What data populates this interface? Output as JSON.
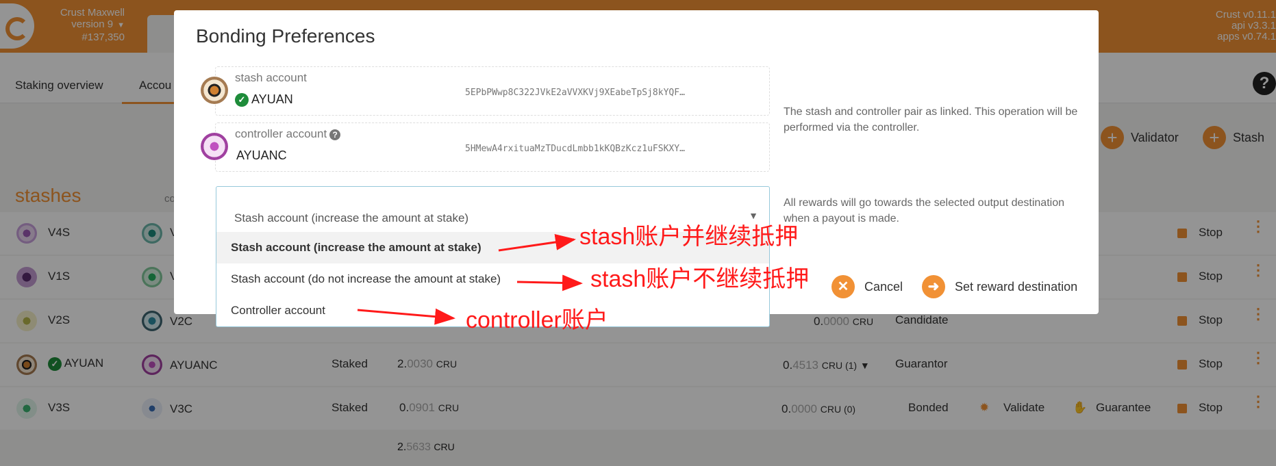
{
  "header": {
    "chain_name": "Crust Maxwell",
    "chain_version": "version 9",
    "block_number": "#137,350",
    "versions": [
      "Crust v0.11.1",
      "api v3.3.1",
      "apps v0.74.1"
    ]
  },
  "subnav": {
    "tabs": [
      "Staking overview",
      "Accou"
    ],
    "help": "?"
  },
  "actions": {
    "validator_label": "Validator",
    "stash_label": "Stash",
    "plus": "+"
  },
  "stashes": {
    "title": "stashes",
    "col_hint": "co",
    "rows": [
      {
        "stash": "V4S",
        "controller": "V",
        "status": "",
        "bonded": "",
        "bonded_dim": "",
        "unit": "",
        "rewards": "",
        "state": "",
        "stop": "Stop"
      },
      {
        "stash": "V1S",
        "controller": "V",
        "status": "",
        "bonded": "",
        "bonded_dim": "",
        "unit": "",
        "rewards": "",
        "state": "",
        "stop": "Stop"
      },
      {
        "stash": "V2S",
        "controller": "V2C",
        "status": "",
        "bonded": "",
        "bonded_dim": "",
        "unit": "",
        "rewards_main": "0.",
        "rewards_dim": "0000",
        "rewards_unit": "CRU",
        "state": "Candidate",
        "stop": "Stop"
      },
      {
        "stash": "AYUAN",
        "controller": "AYUANC",
        "status": "Staked",
        "bonded": "2.",
        "bonded_dim": "0030",
        "unit": "CRU",
        "rewards_main": "0.",
        "rewards_dim": "4513",
        "rewards_unit": "CRU (1)",
        "state": "Guarantor",
        "stop": "Stop"
      },
      {
        "stash": "V3S",
        "controller": "V3C",
        "status": "Staked",
        "bonded": "0.",
        "bonded_dim": "0901",
        "unit": "CRU",
        "rewards_main": "0.",
        "rewards_dim": "0000",
        "rewards_unit": "CRU (0)",
        "state": "Bonded",
        "validate": "Validate",
        "guarantee": "Guarantee",
        "stop": "Stop"
      }
    ],
    "total_main": "2.",
    "total_dim": "5633",
    "total_unit": "CRU"
  },
  "modal": {
    "title": "Bonding Preferences",
    "stash_label": "stash account",
    "stash_name": "AYUAN",
    "stash_address": "5EPbPWwp8C322JVkE2aVVXKVj9XEabeTpSj8kYQF…",
    "controller_label": "controller account",
    "controller_name": "AYUANC",
    "controller_address": "5HMewA4rxituaMzTDucdLmbb1kKQBzKcz1uFSKXY…",
    "help_pair": "The stash and controller pair as linked. This operation will be performed via the controller.",
    "help_rewards": "All rewards will go towards the selected output destination when a payout is made.",
    "dropdown": {
      "current": "Stash account (increase the amount at stake)",
      "options": [
        "Stash account (increase the amount at stake)",
        "Stash account (do not increase the amount at stake)",
        "Controller account"
      ]
    },
    "cancel_label": "Cancel",
    "submit_label": "Set reward destination"
  },
  "annotations": [
    "stash账户并继续抵押",
    "stash账户不继续抵押",
    "controller账户"
  ],
  "colors": {
    "accent": "#f19135",
    "annotation": "#ff1a1a",
    "success": "#1e8c3a"
  }
}
